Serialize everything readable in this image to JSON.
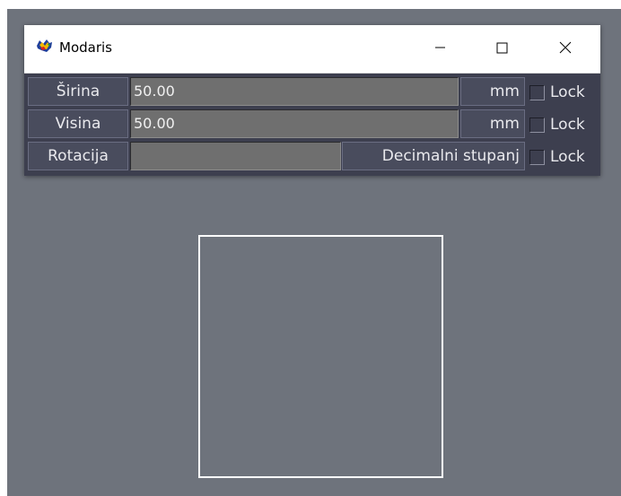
{
  "window": {
    "title": "Modaris",
    "icon": "modaris-app-icon",
    "controls": {
      "minimize_icon": "minimize-icon",
      "maximize_icon": "maximize-icon",
      "close_icon": "close-icon"
    }
  },
  "colors": {
    "canvas": "#6e737c",
    "panel": "#3d3f4f",
    "button": "#494c5d",
    "field": "#6f6f6f",
    "text": "#e9e9ed",
    "shape_outline": "#ffffff"
  },
  "rows": [
    {
      "label": "Širina",
      "value": "50.00",
      "unit": "mm",
      "lock_label": "Lock",
      "locked": false
    },
    {
      "label": "Visina",
      "value": "50.00",
      "unit": "mm",
      "lock_label": "Lock",
      "locked": false
    },
    {
      "label": "Rotacija",
      "value": "",
      "unit": "Decimalni stupanj",
      "lock_label": "Lock",
      "locked": false
    }
  ],
  "canvas": {
    "shape": "rectangle-outline"
  }
}
